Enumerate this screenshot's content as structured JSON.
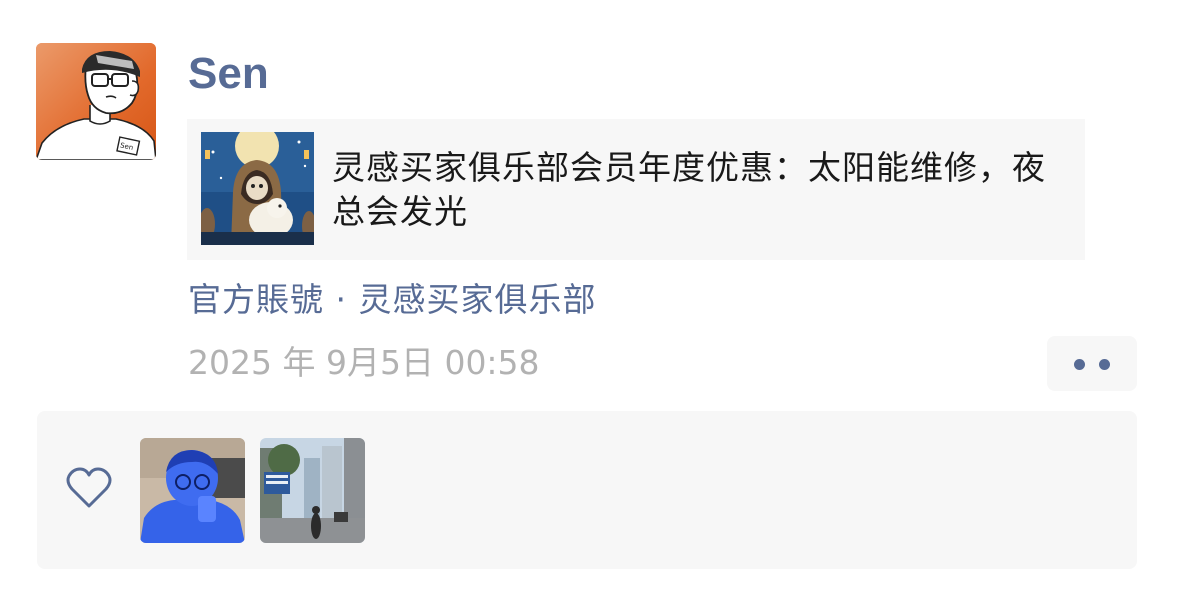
{
  "post": {
    "author": "Sen",
    "avatar_icon": "cartoon-avatar-glasses",
    "shared_article": {
      "title": "灵感买家俱乐部会员年度优惠：太阳能维修，夜总会发光",
      "thumbnail_icon": "hooded-figure-illustration"
    },
    "source": "官方賬號 · 灵感买家俱乐部",
    "timestamp": "2025 年 9月5日 00:58",
    "more_icon": "two-dots-icon"
  },
  "likes": {
    "icon": "heart-outline-icon",
    "liker_avatars": [
      "blue-tinted-person-photo",
      "street-scene-photo"
    ]
  },
  "colors": {
    "link_blue": "#576b95",
    "timestamp_gray": "#b2b2b2",
    "panel_bg": "#f7f7f7",
    "avatar_orange": "#e26a2c"
  }
}
